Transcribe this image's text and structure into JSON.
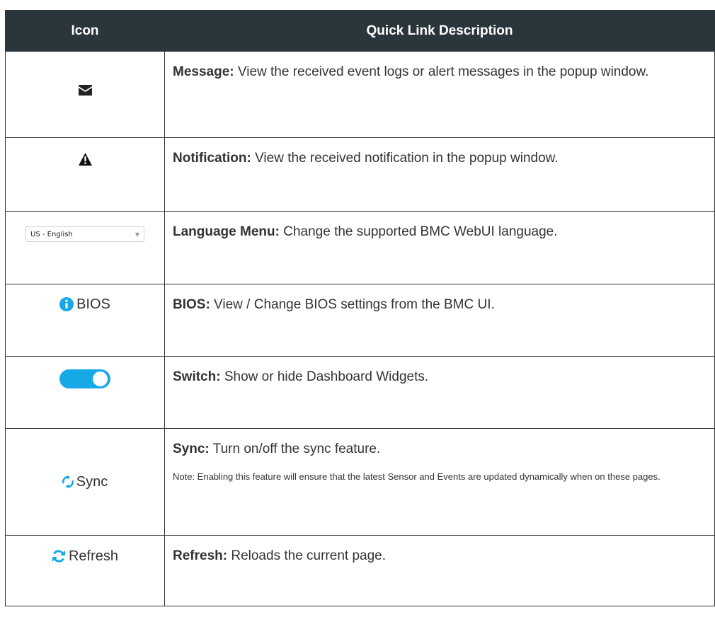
{
  "table": {
    "headers": {
      "icon": "Icon",
      "description": "Quick Link Description"
    },
    "rows": [
      {
        "icon_name": "envelope-icon",
        "label": "Message:",
        "text": " View the received event logs or alert messages in the popup window."
      },
      {
        "icon_name": "warning-icon",
        "label": "Notification:",
        "text": " View the received notification in the popup window."
      },
      {
        "icon_name": "language-dropdown",
        "dropdown_value": "US - English",
        "label": "Language Menu:",
        "text": " Change the supported BMC WebUI language."
      },
      {
        "icon_name": "info-icon",
        "icon_text": "BIOS",
        "label": "BIOS:",
        "text": " View / Change BIOS settings from the BMC UI."
      },
      {
        "icon_name": "toggle-switch-icon",
        "switch_on": true,
        "label": "Switch:",
        "text": " Show or hide Dashboard Widgets."
      },
      {
        "icon_name": "sync-icon",
        "icon_text": "Sync",
        "label": "Sync:",
        "text": " Turn on/off the sync feature.",
        "note": "Note: Enabling this feature will ensure that the latest Sensor and Events are updated dynamically when on these pages."
      },
      {
        "icon_name": "refresh-icon",
        "icon_text": "Refresh",
        "label": "Refresh:",
        "text": " Reloads the current page."
      }
    ]
  },
  "colors": {
    "header_bg": "#2b363c",
    "accent_blue": "#17a8e8",
    "text": "#333333"
  }
}
